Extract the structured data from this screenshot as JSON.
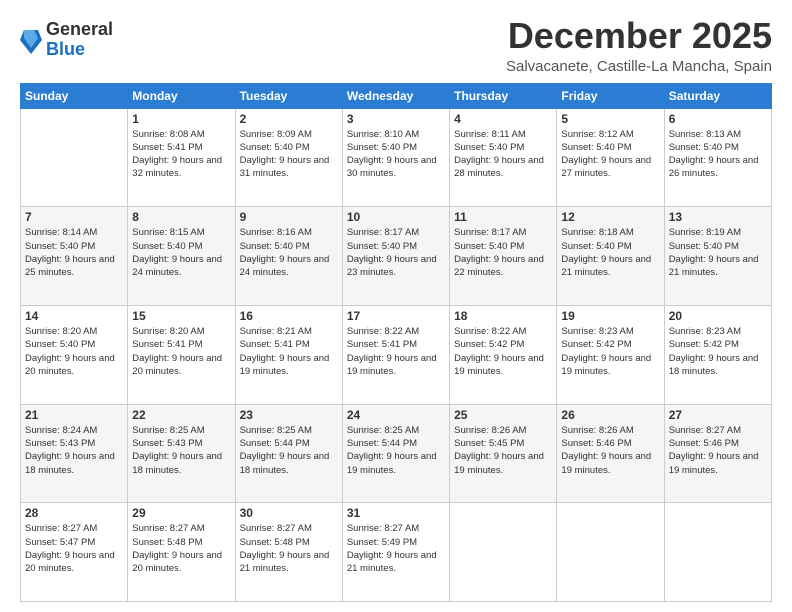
{
  "logo": {
    "general": "General",
    "blue": "Blue"
  },
  "title": {
    "month": "December 2025",
    "location": "Salvacanete, Castille-La Mancha, Spain"
  },
  "weekdays": [
    "Sunday",
    "Monday",
    "Tuesday",
    "Wednesday",
    "Thursday",
    "Friday",
    "Saturday"
  ],
  "weeks": [
    [
      {
        "day": "",
        "sunrise": "",
        "sunset": "",
        "daylight": ""
      },
      {
        "day": "1",
        "sunrise": "Sunrise: 8:08 AM",
        "sunset": "Sunset: 5:41 PM",
        "daylight": "Daylight: 9 hours and 32 minutes."
      },
      {
        "day": "2",
        "sunrise": "Sunrise: 8:09 AM",
        "sunset": "Sunset: 5:40 PM",
        "daylight": "Daylight: 9 hours and 31 minutes."
      },
      {
        "day": "3",
        "sunrise": "Sunrise: 8:10 AM",
        "sunset": "Sunset: 5:40 PM",
        "daylight": "Daylight: 9 hours and 30 minutes."
      },
      {
        "day": "4",
        "sunrise": "Sunrise: 8:11 AM",
        "sunset": "Sunset: 5:40 PM",
        "daylight": "Daylight: 9 hours and 28 minutes."
      },
      {
        "day": "5",
        "sunrise": "Sunrise: 8:12 AM",
        "sunset": "Sunset: 5:40 PM",
        "daylight": "Daylight: 9 hours and 27 minutes."
      },
      {
        "day": "6",
        "sunrise": "Sunrise: 8:13 AM",
        "sunset": "Sunset: 5:40 PM",
        "daylight": "Daylight: 9 hours and 26 minutes."
      }
    ],
    [
      {
        "day": "7",
        "sunrise": "Sunrise: 8:14 AM",
        "sunset": "Sunset: 5:40 PM",
        "daylight": "Daylight: 9 hours and 25 minutes."
      },
      {
        "day": "8",
        "sunrise": "Sunrise: 8:15 AM",
        "sunset": "Sunset: 5:40 PM",
        "daylight": "Daylight: 9 hours and 24 minutes."
      },
      {
        "day": "9",
        "sunrise": "Sunrise: 8:16 AM",
        "sunset": "Sunset: 5:40 PM",
        "daylight": "Daylight: 9 hours and 24 minutes."
      },
      {
        "day": "10",
        "sunrise": "Sunrise: 8:17 AM",
        "sunset": "Sunset: 5:40 PM",
        "daylight": "Daylight: 9 hours and 23 minutes."
      },
      {
        "day": "11",
        "sunrise": "Sunrise: 8:17 AM",
        "sunset": "Sunset: 5:40 PM",
        "daylight": "Daylight: 9 hours and 22 minutes."
      },
      {
        "day": "12",
        "sunrise": "Sunrise: 8:18 AM",
        "sunset": "Sunset: 5:40 PM",
        "daylight": "Daylight: 9 hours and 21 minutes."
      },
      {
        "day": "13",
        "sunrise": "Sunrise: 8:19 AM",
        "sunset": "Sunset: 5:40 PM",
        "daylight": "Daylight: 9 hours and 21 minutes."
      }
    ],
    [
      {
        "day": "14",
        "sunrise": "Sunrise: 8:20 AM",
        "sunset": "Sunset: 5:40 PM",
        "daylight": "Daylight: 9 hours and 20 minutes."
      },
      {
        "day": "15",
        "sunrise": "Sunrise: 8:20 AM",
        "sunset": "Sunset: 5:41 PM",
        "daylight": "Daylight: 9 hours and 20 minutes."
      },
      {
        "day": "16",
        "sunrise": "Sunrise: 8:21 AM",
        "sunset": "Sunset: 5:41 PM",
        "daylight": "Daylight: 9 hours and 19 minutes."
      },
      {
        "day": "17",
        "sunrise": "Sunrise: 8:22 AM",
        "sunset": "Sunset: 5:41 PM",
        "daylight": "Daylight: 9 hours and 19 minutes."
      },
      {
        "day": "18",
        "sunrise": "Sunrise: 8:22 AM",
        "sunset": "Sunset: 5:42 PM",
        "daylight": "Daylight: 9 hours and 19 minutes."
      },
      {
        "day": "19",
        "sunrise": "Sunrise: 8:23 AM",
        "sunset": "Sunset: 5:42 PM",
        "daylight": "Daylight: 9 hours and 19 minutes."
      },
      {
        "day": "20",
        "sunrise": "Sunrise: 8:23 AM",
        "sunset": "Sunset: 5:42 PM",
        "daylight": "Daylight: 9 hours and 18 minutes."
      }
    ],
    [
      {
        "day": "21",
        "sunrise": "Sunrise: 8:24 AM",
        "sunset": "Sunset: 5:43 PM",
        "daylight": "Daylight: 9 hours and 18 minutes."
      },
      {
        "day": "22",
        "sunrise": "Sunrise: 8:25 AM",
        "sunset": "Sunset: 5:43 PM",
        "daylight": "Daylight: 9 hours and 18 minutes."
      },
      {
        "day": "23",
        "sunrise": "Sunrise: 8:25 AM",
        "sunset": "Sunset: 5:44 PM",
        "daylight": "Daylight: 9 hours and 18 minutes."
      },
      {
        "day": "24",
        "sunrise": "Sunrise: 8:25 AM",
        "sunset": "Sunset: 5:44 PM",
        "daylight": "Daylight: 9 hours and 19 minutes."
      },
      {
        "day": "25",
        "sunrise": "Sunrise: 8:26 AM",
        "sunset": "Sunset: 5:45 PM",
        "daylight": "Daylight: 9 hours and 19 minutes."
      },
      {
        "day": "26",
        "sunrise": "Sunrise: 8:26 AM",
        "sunset": "Sunset: 5:46 PM",
        "daylight": "Daylight: 9 hours and 19 minutes."
      },
      {
        "day": "27",
        "sunrise": "Sunrise: 8:27 AM",
        "sunset": "Sunset: 5:46 PM",
        "daylight": "Daylight: 9 hours and 19 minutes."
      }
    ],
    [
      {
        "day": "28",
        "sunrise": "Sunrise: 8:27 AM",
        "sunset": "Sunset: 5:47 PM",
        "daylight": "Daylight: 9 hours and 20 minutes."
      },
      {
        "day": "29",
        "sunrise": "Sunrise: 8:27 AM",
        "sunset": "Sunset: 5:48 PM",
        "daylight": "Daylight: 9 hours and 20 minutes."
      },
      {
        "day": "30",
        "sunrise": "Sunrise: 8:27 AM",
        "sunset": "Sunset: 5:48 PM",
        "daylight": "Daylight: 9 hours and 21 minutes."
      },
      {
        "day": "31",
        "sunrise": "Sunrise: 8:27 AM",
        "sunset": "Sunset: 5:49 PM",
        "daylight": "Daylight: 9 hours and 21 minutes."
      },
      {
        "day": "",
        "sunrise": "",
        "sunset": "",
        "daylight": ""
      },
      {
        "day": "",
        "sunrise": "",
        "sunset": "",
        "daylight": ""
      },
      {
        "day": "",
        "sunrise": "",
        "sunset": "",
        "daylight": ""
      }
    ]
  ]
}
